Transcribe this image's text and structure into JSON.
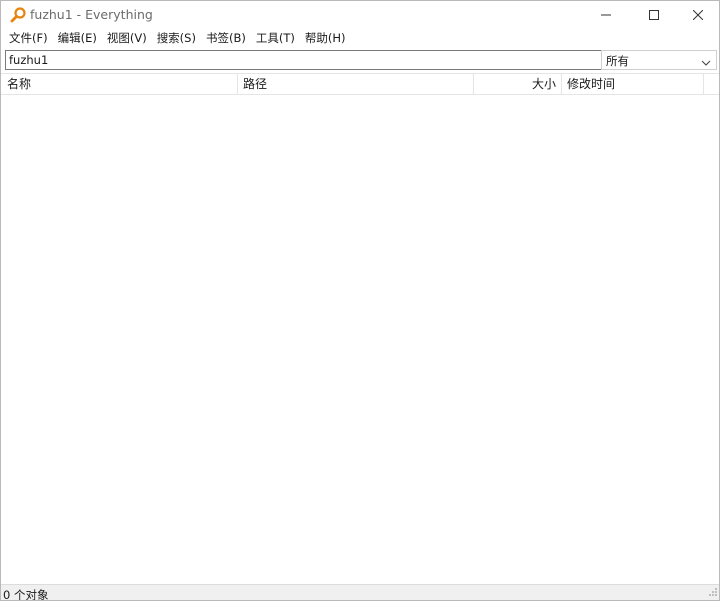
{
  "window": {
    "title": "fuzhu1 - Everything"
  },
  "menu": {
    "items": [
      {
        "label": "文件(F)"
      },
      {
        "label": "编辑(E)"
      },
      {
        "label": "视图(V)"
      },
      {
        "label": "搜索(S)"
      },
      {
        "label": "书签(B)"
      },
      {
        "label": "工具(T)"
      },
      {
        "label": "帮助(H)"
      }
    ]
  },
  "search": {
    "value": "fuzhu1",
    "filter_selected": "所有"
  },
  "columns": {
    "name": "名称",
    "path": "路径",
    "size": "大小",
    "modified": "修改时间"
  },
  "results": [],
  "status": {
    "text": "0 个对象"
  },
  "icons": {
    "app": "everything-magnifier-icon",
    "minimize": "minimize-icon",
    "maximize": "maximize-icon",
    "close": "close-icon",
    "dropdown": "chevron-down-icon"
  },
  "colors": {
    "accent": "#e8830e"
  }
}
